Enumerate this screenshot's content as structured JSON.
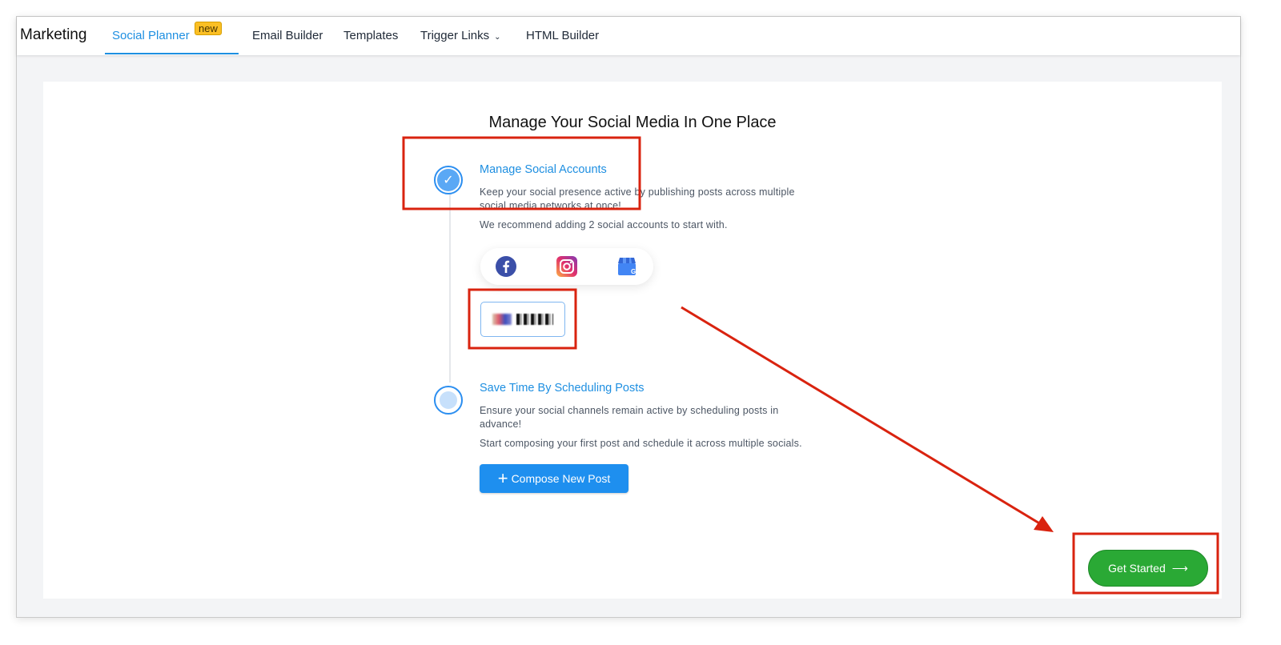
{
  "nav": {
    "brand": "Marketing",
    "tabs": [
      {
        "label": "Social Planner",
        "active": true,
        "badge": "new"
      },
      {
        "label": "Email Builder"
      },
      {
        "label": "Templates"
      },
      {
        "label": "Trigger Links",
        "dropdown": true
      },
      {
        "label": "HTML Builder"
      }
    ]
  },
  "main": {
    "title": "Manage Your Social Media In One Place",
    "step1": {
      "heading": "Manage Social Accounts",
      "text": "Keep your social presence active by publishing posts across multiple social media networks at once!",
      "recommend": "We recommend adding 2 social accounts to start with.",
      "status": "completed",
      "socials": [
        "facebook-icon",
        "instagram-icon",
        "google-business-icon"
      ]
    },
    "step2": {
      "heading": "Save Time By Scheduling Posts",
      "text": "Ensure your social channels remain active by scheduling posts in advance!",
      "compose_hint": "Start composing your first post and schedule it across multiple socials.",
      "compose_label": "Compose New Post"
    },
    "get_started_label": "Get Started",
    "get_started_arrow": "⟶"
  },
  "colors": {
    "accent": "#1e8fe1",
    "success": "#2aa935",
    "annotation": "#d9230f",
    "badge": "#fbbf24"
  }
}
